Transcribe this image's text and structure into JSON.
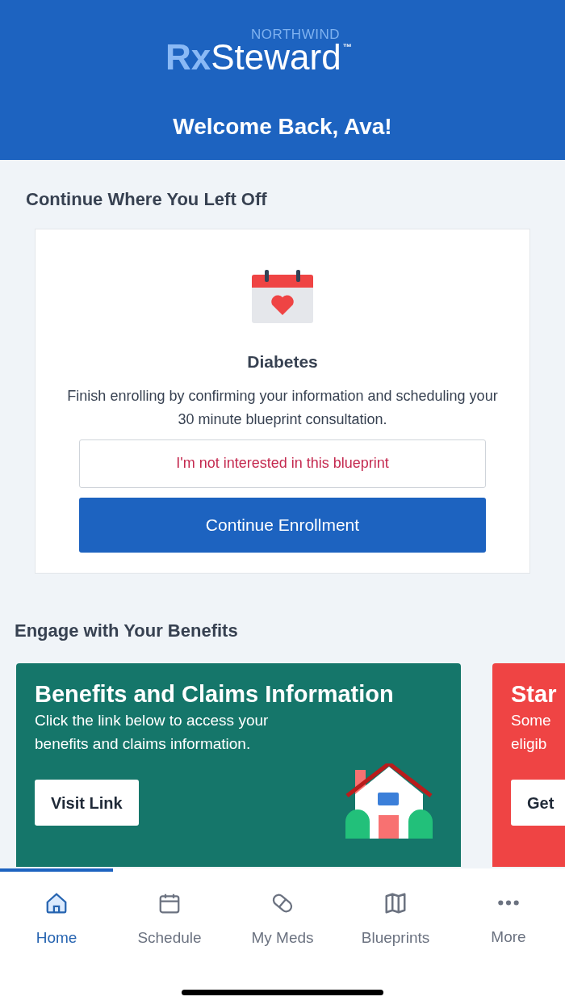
{
  "header": {
    "logo": {
      "brand": "NORTHWIND",
      "prefix": "Rx",
      "name": "Steward",
      "trademark": "™"
    },
    "welcome": "Welcome Back, Ava!"
  },
  "continue_section": {
    "title": "Continue Where You Left Off",
    "card": {
      "title": "Diabetes",
      "description": "Finish enrolling by confirming your information and scheduling your 30 minute blueprint consultation.",
      "decline_button": "I'm not interested in this blueprint",
      "continue_button": "Continue Enrollment"
    }
  },
  "benefits_section": {
    "title": "Engage with Your Benefits",
    "cards": [
      {
        "kind": "house",
        "color": "#15766a",
        "title": "Benefits and Claims Information",
        "lines": [
          "Click the link below to access your",
          "benefits and claims information."
        ],
        "button": "Visit Link"
      },
      {
        "kind": "plain",
        "color": "#ef4444",
        "title": "Star",
        "lines": [
          "Some",
          "eligib"
        ],
        "button": "Get"
      }
    ]
  },
  "tab_bar": {
    "tabs": [
      {
        "label": "Home",
        "kind": "home",
        "selected": true
      },
      {
        "label": "Schedule",
        "kind": "calendar",
        "selected": false
      },
      {
        "label": "My Meds",
        "kind": "pill",
        "selected": false
      },
      {
        "label": "Blueprints",
        "kind": "map",
        "selected": false
      },
      {
        "label": "More",
        "kind": "dots",
        "selected": false
      }
    ]
  }
}
